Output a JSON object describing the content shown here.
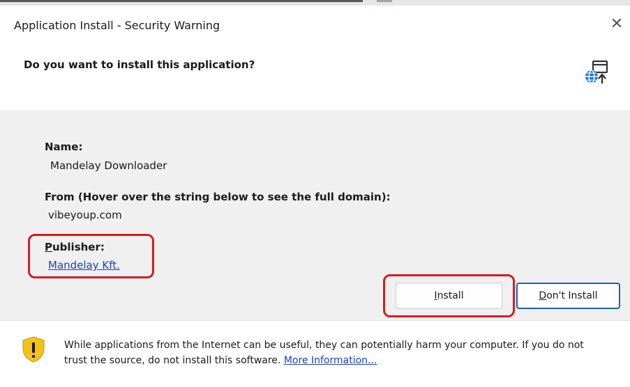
{
  "window": {
    "title": "Application Install - Security Warning",
    "close_glyph": "✕"
  },
  "header": {
    "question": "Do you want to install this application?",
    "app_icon": "globe-install-icon"
  },
  "details": {
    "name_label": "Name:",
    "name_value": "Mandelay Downloader",
    "from_label": "From (Hover over the string below to see the full domain):",
    "from_value": "vibeyoup.com",
    "publisher_label_first": "P",
    "publisher_label_rest": "ublisher:",
    "publisher_value": "Mandelay Kft."
  },
  "buttons": {
    "install_first": "I",
    "install_rest": "nstall",
    "dont_install_first": "D",
    "dont_install_rest": "on't Install"
  },
  "footer": {
    "icon": "shield-warning-icon",
    "warning_text": "While applications from the Internet can be useful, they can potentially harm your computer. If you do not trust the source, do not install this software.",
    "more_info_link": "More Information..."
  },
  "colors": {
    "highlight": "#d41c24",
    "link": "#1a3fbf",
    "default_button_border": "#1b5fb6",
    "shield": "#f2c21b"
  }
}
